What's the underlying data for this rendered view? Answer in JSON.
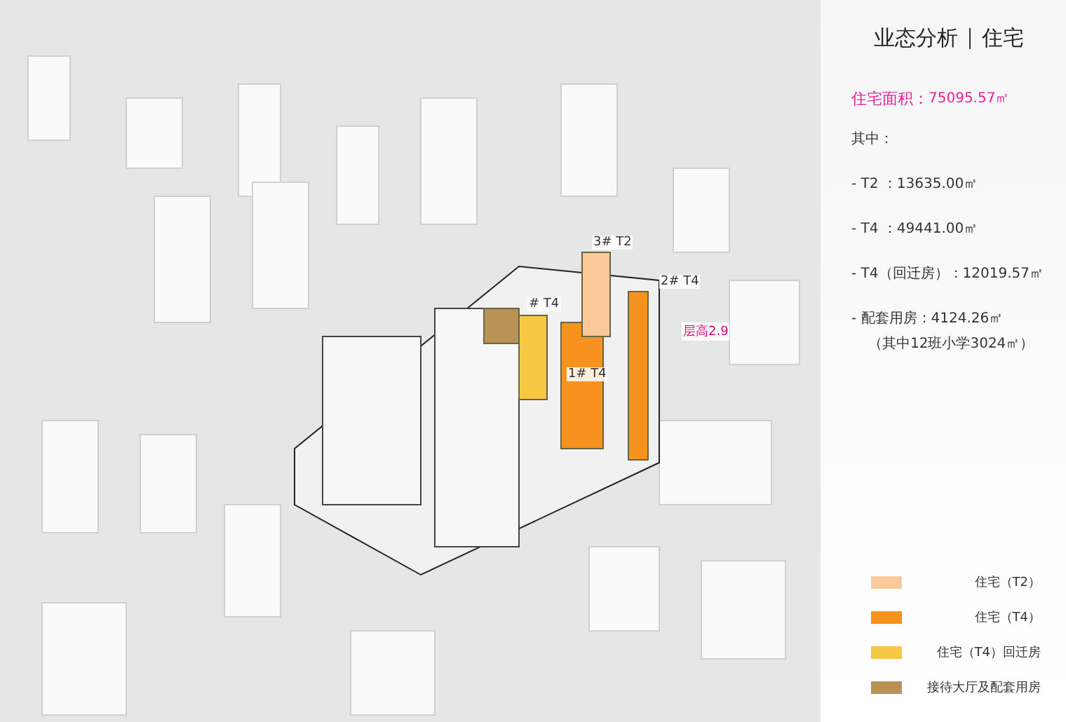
{
  "map": {
    "labels": [
      {
        "text": "3# T2",
        "kind": "building"
      },
      {
        "text": "2# T4",
        "kind": "building"
      },
      {
        "text": "# T4",
        "kind": "building"
      },
      {
        "text": "1# T4",
        "kind": "building"
      },
      {
        "text": "层高2.9",
        "kind": "note"
      }
    ]
  },
  "panel": {
    "title": "业态分析",
    "subtitle": "住宅",
    "total_label": "住宅面积：",
    "total_value": "75095.57㎡",
    "intro": "其中：",
    "items": [
      {
        "text": "- T2 ：13635.00㎡"
      },
      {
        "text": "- T4 ：49441.00㎡"
      },
      {
        "text": "- T4（回迁房）：12019.57㎡"
      },
      {
        "text": "- 配套用房：4124.26㎡",
        "note": "（其中12班小学3024㎡）"
      }
    ],
    "legend": [
      {
        "label": "住宅（T2）",
        "color": "#fcc99a"
      },
      {
        "label": "住宅（T4）",
        "color": "#f7921e"
      },
      {
        "label": "住宅（T4）回迁房",
        "color": "#f7c844"
      },
      {
        "label": "接待大厅及配套用房",
        "color": "#b99356"
      }
    ]
  }
}
